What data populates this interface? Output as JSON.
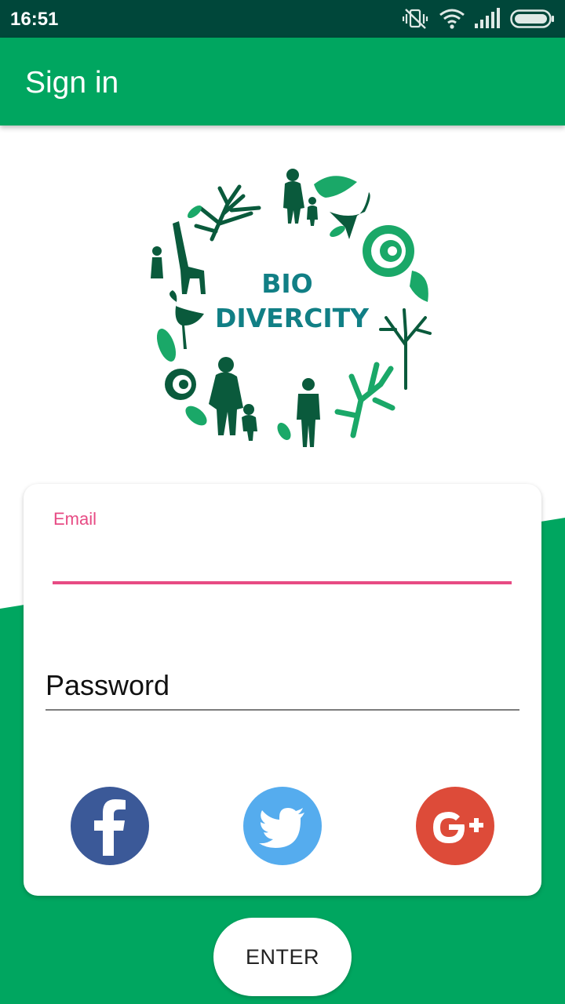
{
  "status_bar": {
    "time": "16:51",
    "icons": [
      "vibrate-off-icon",
      "wifi-icon",
      "signal-icon",
      "battery-icon"
    ]
  },
  "app_bar": {
    "title": "Sign in",
    "background_color": "#00a660"
  },
  "logo": {
    "line1": "BIO",
    "line2": "DIVERCITY",
    "text_color": "#117f85"
  },
  "form": {
    "email": {
      "label": "Email",
      "value": "",
      "accent_color": "#e74b84"
    },
    "password": {
      "label": "Password",
      "value": ""
    },
    "social_buttons": [
      {
        "name": "facebook",
        "icon": "facebook-icon",
        "color": "#3b5998"
      },
      {
        "name": "twitter",
        "icon": "twitter-icon",
        "color": "#55acee"
      },
      {
        "name": "google-plus",
        "icon": "google-plus-icon",
        "color": "#dd4b39",
        "glyph": "G+"
      }
    ]
  },
  "enter_button": {
    "label": "ENTER"
  },
  "colors": {
    "primary": "#00a660",
    "status_bar": "#00473a"
  }
}
